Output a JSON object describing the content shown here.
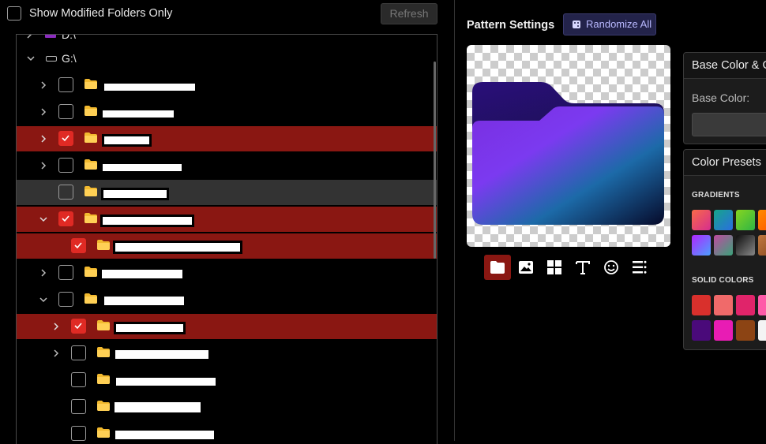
{
  "top": {
    "show_modified_label": "Show Modified Folders Only",
    "refresh_label": "Refresh"
  },
  "tree": {
    "drive_d_label": "D:\\",
    "drive_g_label": "G:\\"
  },
  "pattern": {
    "title": "Pattern Settings",
    "randomize_label": "Randomize All"
  },
  "toolbar": {
    "icons": [
      "folder-icon",
      "image-icon",
      "grid-icon",
      "text-icon",
      "emoji-icon",
      "list-icon"
    ],
    "active": "folder-icon"
  },
  "panels": {
    "base": {
      "header": "Base Color & G",
      "base_color_label": "Base Color:"
    },
    "presets": {
      "header": "Color Presets",
      "gradients_label": "GRADIENTS",
      "solid_label": "SOLID COLORS"
    }
  },
  "colors": {
    "accent_red": "#8a1712",
    "checkbox_red": "#e02a24",
    "gradients": [
      [
        "#f86a48",
        "#d62d8f"
      ],
      [
        "#16a58a",
        "#2a6ee0"
      ],
      [
        "#86d520",
        "#2fb544"
      ],
      [
        "#ff8a00",
        "#ff5500"
      ],
      [
        "#b026ff",
        "#4ba0ff"
      ],
      [
        "#c04aa0",
        "#3aa37a"
      ],
      [
        "#0f0f0f",
        "#888888"
      ],
      [
        "#c07840",
        "#8a4a20"
      ]
    ],
    "solids": [
      "#d9302c",
      "#f06a6a",
      "#e0246a",
      "#ff5aa8",
      "#4a0a7a",
      "#e81cb4",
      "#8c4414",
      "#f4f4f4"
    ]
  }
}
